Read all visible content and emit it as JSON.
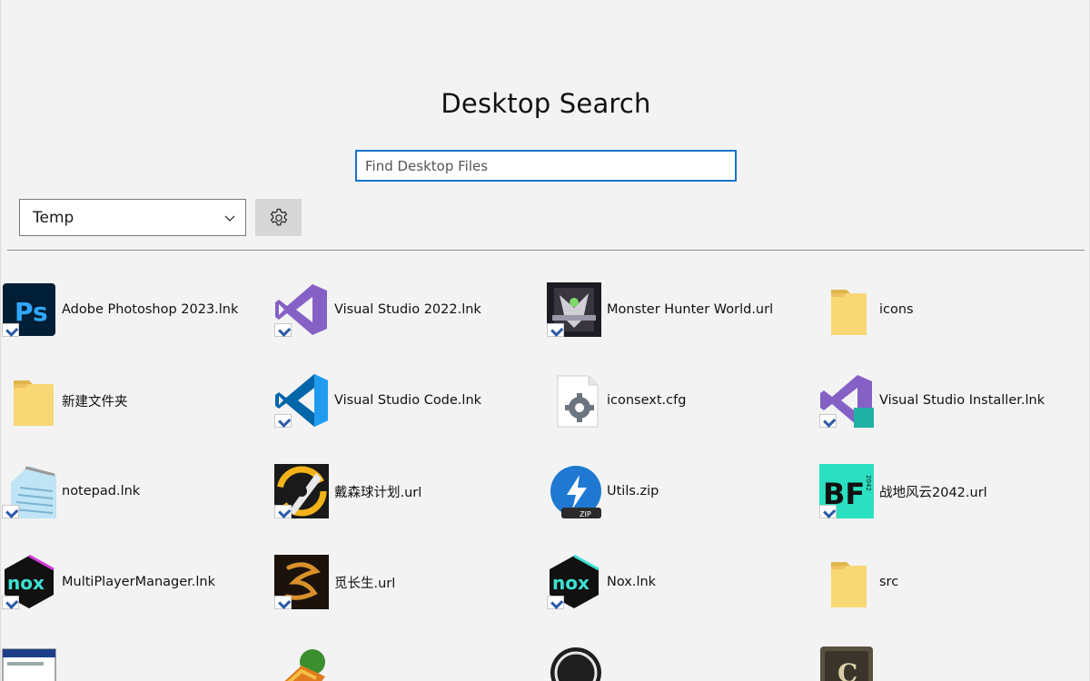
{
  "app": {
    "title": "Desktop Search"
  },
  "search": {
    "placeholder": "Find Desktop Files",
    "value": ""
  },
  "folder_dropdown": {
    "selected": "Temp",
    "icon": "chevron-down-icon"
  },
  "settings_button": {
    "icon": "gear-icon"
  },
  "files": [
    {
      "name": "Adobe Photoshop 2023.lnk",
      "icon": "photoshop-icon"
    },
    {
      "name": "Visual Studio 2022.lnk",
      "icon": "visual-studio-icon"
    },
    {
      "name": "Monster Hunter World.url",
      "icon": "monster-hunter-icon"
    },
    {
      "name": "icons",
      "icon": "folder-icon"
    },
    {
      "name": "新建文件夹",
      "icon": "folder-icon"
    },
    {
      "name": "Visual Studio Code.lnk",
      "icon": "vscode-icon"
    },
    {
      "name": "iconsext.cfg",
      "icon": "config-file-icon"
    },
    {
      "name": "Visual Studio Installer.lnk",
      "icon": "visual-studio-installer-icon"
    },
    {
      "name": "notepad.lnk",
      "icon": "notepad-icon"
    },
    {
      "name": "戴森球计划.url",
      "icon": "dyson-sphere-icon"
    },
    {
      "name": "Utils.zip",
      "icon": "zip-archive-icon"
    },
    {
      "name": "战地风云2042.url",
      "icon": "battlefield-icon"
    },
    {
      "name": "MultiPlayerManager.lnk",
      "icon": "nox-icon"
    },
    {
      "name": "觅长生.url",
      "icon": "game-icon"
    },
    {
      "name": "Nox.lnk",
      "icon": "nox-icon"
    },
    {
      "name": "src",
      "icon": "folder-icon"
    },
    {
      "name": "",
      "icon": "application-window-icon"
    },
    {
      "name": "",
      "icon": "download-manager-icon"
    },
    {
      "name": "",
      "icon": "obs-icon"
    },
    {
      "name": "",
      "icon": "game-icon"
    }
  ]
}
